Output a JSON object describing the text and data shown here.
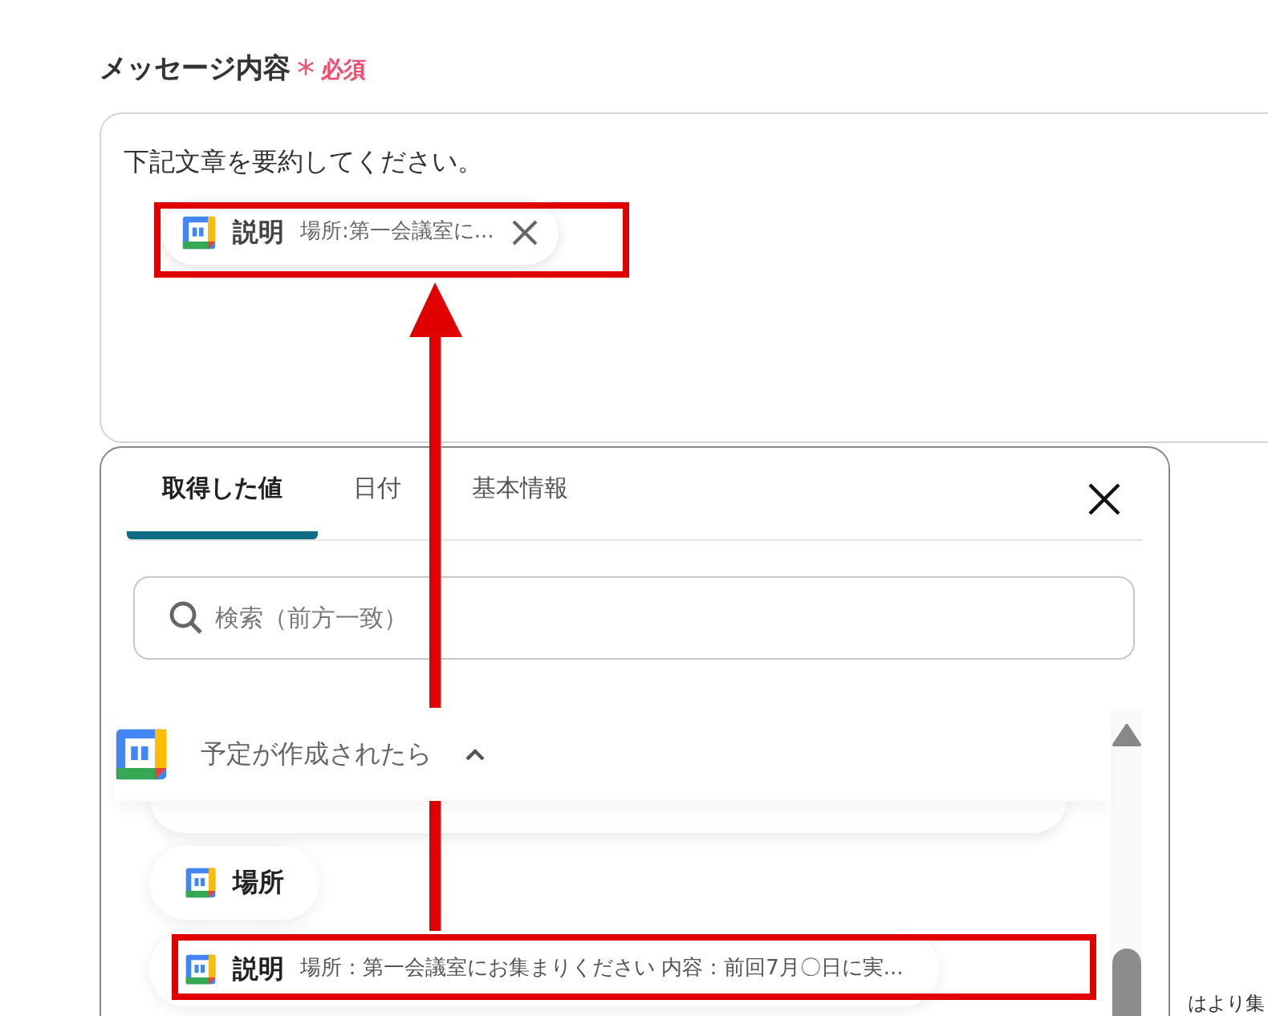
{
  "field": {
    "label": "メッセージ内容",
    "required_mark": "*",
    "required_text": "必須"
  },
  "editor": {
    "text": "下記文章を要約してください。",
    "chips": [
      {
        "label": "説明",
        "value": "場所:第一会議室に..."
      }
    ]
  },
  "popup": {
    "tabs": [
      {
        "label": "取得した値",
        "selected": true
      },
      {
        "label": "日付",
        "selected": false
      },
      {
        "label": "基本情報",
        "selected": false
      }
    ],
    "search": {
      "placeholder": "検索（前方一致）"
    },
    "group": {
      "title": "予定が作成されたら",
      "expanded": true
    },
    "items": [
      {
        "label": "場所"
      },
      {
        "label": "説明",
        "value": "場所：第一会議室にお集まりください 内容：前回7月〇日に実..."
      }
    ]
  },
  "side_text": "はより集"
}
